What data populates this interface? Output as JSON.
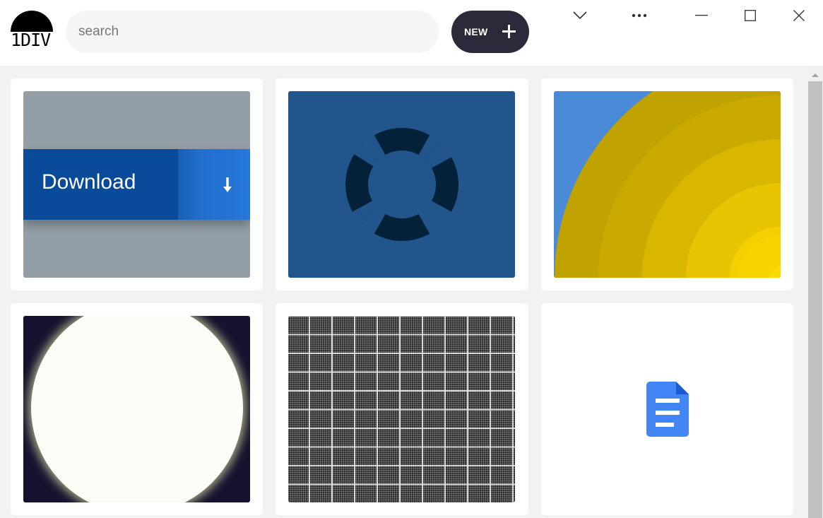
{
  "app": {
    "logo_text": "1DIV"
  },
  "search": {
    "placeholder": "search",
    "value": ""
  },
  "new_button": {
    "label": "NEW"
  },
  "window_controls": [
    "chevron-down-icon",
    "more-icon",
    "minimize-icon",
    "maximize-icon",
    "close-icon"
  ],
  "cards": [
    {
      "id": "download-button-preview",
      "label": "Download",
      "icon": "download-arrow-icon"
    },
    {
      "id": "lifebuoy-preview",
      "icon": "lifebuoy-icon"
    },
    {
      "id": "sun-rings-preview"
    },
    {
      "id": "moon-preview"
    },
    {
      "id": "grid-pattern-preview"
    },
    {
      "id": "document-preview",
      "icon": "google-docs-icon"
    }
  ],
  "colors": {
    "accent_dark": "#2a2a3a",
    "download_blue": "#0a4a9a",
    "lifebuoy_bg": "#22558c",
    "sun_bg": "#4a8ad6",
    "sun_yellow": "#f5cf00",
    "moon_bg": "#14122e",
    "docs_blue": "#4285f4"
  }
}
